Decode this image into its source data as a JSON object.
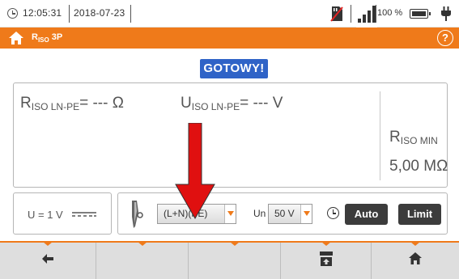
{
  "status_bar": {
    "time": "12:05:31",
    "date": "2018-07-23",
    "battery_percent": "100 %",
    "signal_level": 4,
    "icons": [
      "clock-icon",
      "memory-card-icon",
      "signal-icon",
      "battery-icon",
      "plug-icon"
    ]
  },
  "title_bar": {
    "title_main": "R",
    "title_sub": "ISO",
    "title_suffix": " 3P",
    "help_label": "?",
    "accent_color": "#ef7a1a"
  },
  "status": {
    "label": "GOTOWY!",
    "color": "#2f63c7"
  },
  "results": {
    "riso": {
      "symbol": "R",
      "subscript": "ISO LN-PE",
      "value": "= --- Ω"
    },
    "uiso": {
      "symbol": "U",
      "subscript": "ISO LN-PE",
      "value": "= --- V"
    },
    "riso_min": {
      "symbol": "R",
      "subscript": "ISO MIN",
      "value": "5,00 MΩ"
    }
  },
  "voltage": {
    "label": "U = 1 V",
    "icon": "dc-voltage-icon"
  },
  "settings": {
    "config_selected": "(L+N)(PE)",
    "un_label": "Un",
    "un_selected": "50 V",
    "auto_label": "Auto",
    "limit_label": "Limit"
  },
  "bottom_nav": {
    "buttons": [
      "back-arrow-icon",
      "",
      "",
      "save-icon",
      "home-icon"
    ]
  }
}
